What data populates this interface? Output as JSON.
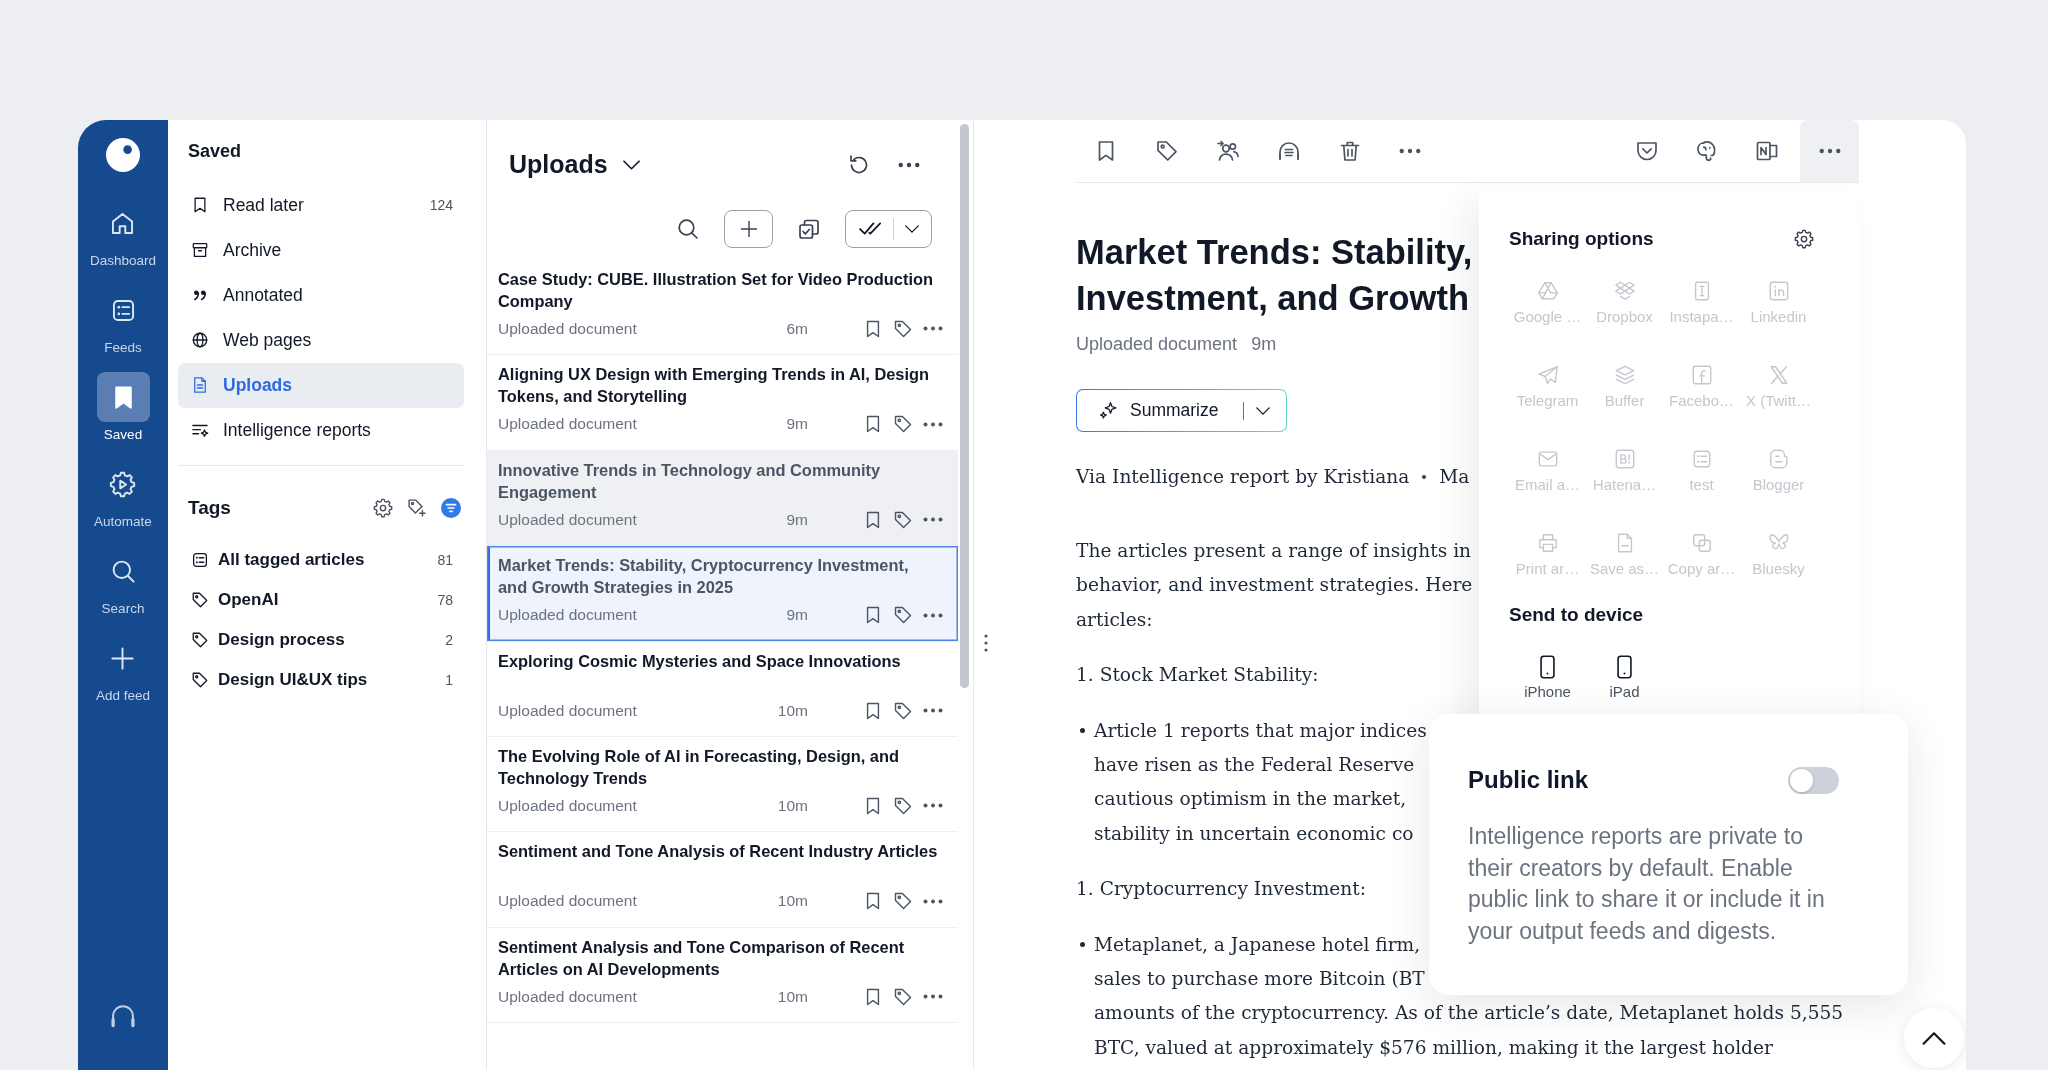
{
  "nav": {
    "items": [
      {
        "label": "Dashboard",
        "selected": false
      },
      {
        "label": "Feeds",
        "selected": false
      },
      {
        "label": "Saved",
        "selected": true
      },
      {
        "label": "Automate",
        "selected": false
      },
      {
        "label": "Search",
        "selected": false
      },
      {
        "label": "Add feed",
        "selected": false
      }
    ]
  },
  "sidebar": {
    "title": "Saved",
    "items": [
      {
        "label": "Read later",
        "count": "124",
        "selected": false
      },
      {
        "label": "Archive",
        "selected": false
      },
      {
        "label": "Annotated",
        "selected": false
      },
      {
        "label": "Web pages",
        "selected": false
      },
      {
        "label": "Uploads",
        "selected": true
      },
      {
        "label": "Intelligence reports",
        "selected": false
      }
    ]
  },
  "tags": {
    "title": "Tags",
    "items": [
      {
        "label": "All tagged articles",
        "count": "81"
      },
      {
        "label": "OpenAI",
        "count": "78"
      },
      {
        "label": "Design process",
        "count": "2"
      },
      {
        "label": "Design UI&UX tips",
        "count": "1"
      }
    ]
  },
  "list": {
    "title": "Uploads",
    "items": [
      {
        "title": "Case Study: CUBE. Illustration Set for Video Production Company",
        "meta": "Uploaded document",
        "time": "6m",
        "read": false,
        "hovered": false,
        "selected": false
      },
      {
        "title": "Aligning UX Design with Emerging Trends in AI, Design Tokens, and Storytelling",
        "meta": "Uploaded document",
        "time": "9m",
        "read": false,
        "hovered": false,
        "selected": false
      },
      {
        "title": "Innovative Trends in Technology and Community Engagement",
        "meta": "Uploaded document",
        "time": "9m",
        "read": true,
        "hovered": true,
        "selected": false
      },
      {
        "title": "Market Trends: Stability, Cryptocurrency Investment, and Growth Strategies in 2025",
        "meta": "Uploaded document",
        "time": "9m",
        "read": true,
        "hovered": false,
        "selected": true
      },
      {
        "title": "Exploring Cosmic Mysteries and Space Innovations",
        "meta": "Uploaded document",
        "time": "10m",
        "read": false,
        "hovered": false,
        "selected": false
      },
      {
        "title": "The Evolving Role of AI in Forecasting, Design, and Technology Trends",
        "meta": "Uploaded document",
        "time": "10m",
        "read": false,
        "hovered": false,
        "selected": false
      },
      {
        "title": "Sentiment and Tone Analysis of Recent Industry Articles",
        "meta": "Uploaded document",
        "time": "10m",
        "read": false,
        "hovered": false,
        "selected": false
      },
      {
        "title": "Sentiment Analysis and Tone Comparison of Recent Articles on AI Developments",
        "meta": "Uploaded document",
        "time": "10m",
        "read": false,
        "hovered": false,
        "selected": false
      }
    ]
  },
  "article": {
    "more_menu_open": true,
    "title_lines": [
      "Market Trends: Stability,",
      "Investment, and Growth"
    ],
    "meta": "Uploaded document",
    "time": "9m",
    "summarize": "Summarize",
    "byline": "Via Intelligence report by Kristiana",
    "byline_more": "Ma",
    "blocks": [
      {
        "kind": "paragraph",
        "lines": [
          "The articles present a range of insights in",
          "behavior, and investment strategies. Here",
          "articles:"
        ]
      },
      {
        "kind": "numbered",
        "text": "1. Stock Market Stability:"
      },
      {
        "kind": "bullet",
        "lines": [
          "Article 1 reports that major indices",
          "have risen as the Federal Reserve",
          "cautious optimism in the market,",
          "stability in uncertain economic co"
        ]
      },
      {
        "kind": "numbered",
        "text": "1. Cryptocurrency Investment:"
      },
      {
        "kind": "bullet",
        "lines": [
          "Metaplanet, a Japanese hotel firm,",
          "sales to purchase more Bitcoin (BT",
          "amounts of the cryptocurrency. As of the article’s date, Metaplanet holds 5,555",
          "BTC, valued at approximately $576 million, making it the largest holder"
        ]
      }
    ]
  },
  "sharing": {
    "title": "Sharing options",
    "options": [
      {
        "label": "Google …",
        "disabled": true
      },
      {
        "label": "Dropbox",
        "disabled": true
      },
      {
        "label": "Instapa…",
        "disabled": true
      },
      {
        "label": "Linkedin",
        "disabled": true
      },
      {
        "label": "Telegram",
        "disabled": true
      },
      {
        "label": "Buffer",
        "disabled": true
      },
      {
        "label": "Facebo…",
        "disabled": true
      },
      {
        "label": "X (Twitt…",
        "disabled": true
      },
      {
        "label": "Email a…",
        "disabled": true
      },
      {
        "label": "Hatena…",
        "disabled": true
      },
      {
        "label": "test",
        "disabled": true
      },
      {
        "label": "Blogger",
        "disabled": true
      },
      {
        "label": "Print ar…",
        "disabled": true
      },
      {
        "label": "Save as…",
        "disabled": true
      },
      {
        "label": "Copy ar…",
        "disabled": true
      },
      {
        "label": "Bluesky",
        "disabled": true
      }
    ],
    "devices_title": "Send to device",
    "devices": [
      {
        "label": "iPhone"
      },
      {
        "label": "iPad"
      }
    ]
  },
  "public_link": {
    "title": "Public link",
    "on": false,
    "description": "Intelligence reports are private to their creators by default. Enable public link to share it or include it in your output feeds and digests."
  }
}
